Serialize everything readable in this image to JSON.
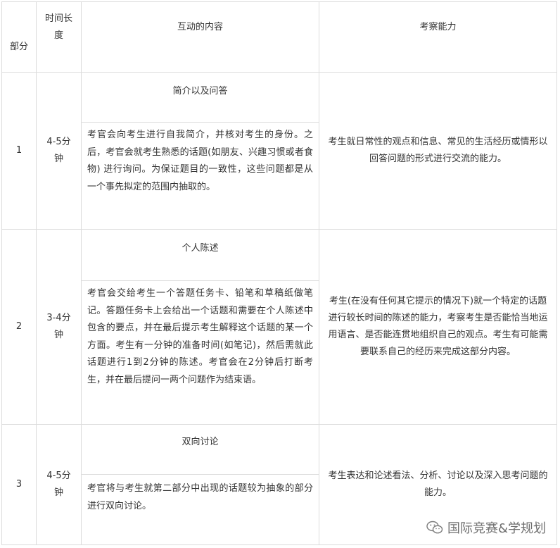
{
  "header": {
    "part": "部分",
    "duration": "时间长度",
    "interaction": "互动的内容",
    "ability": "考察能力"
  },
  "rows": [
    {
      "part": "1",
      "duration": "4-5分钟",
      "title": "简介以及问答",
      "content": "考官会向考生进行自我简介，并核对考生的身份。之后，考官会就考生熟悉的话题(如朋友、兴趣习惯或者食物) 进行询问。为保证题目的一致性，这些问题都是从一个事先拟定的范围内抽取的。",
      "ability": "考生就日常性的观点和信息、常见的生活经历或情形以回答问题的形式进行交流的能力。"
    },
    {
      "part": "2",
      "duration": "3-4分钟",
      "title": "个人陈述",
      "content": "考官会交给考生一个答题任务卡、铅笔和草稿纸做笔记。答题任务卡上会给出一个话题和需要在个人陈述中包含的要点，并在最后提示考生解释这个话题的某一个方面。考生有一分钟的准备时间(如笔记)，然后需就此话题进行1到2分钟的陈述。考官会在2分钟后打断考生，并在最后提问一两个问题作为结束语。",
      "ability": "考生(在没有任何其它提示的情况下)就一个特定的话题进行较长时间的陈述的能力，考察考生是否能恰当地运用语言、是否能连贯地组织自己的观点。考生有可能需要联系自己的经历来完成这部分内容。"
    },
    {
      "part": "3",
      "duration": "4-5分钟",
      "title": "双向讨论",
      "content": "考官将与考生就第二部分中出现的话题较为抽象的部分进行双向讨论。",
      "ability": "考生表达和论述看法、分析、讨论以及深入思考问题的能力。"
    }
  ],
  "watermark": {
    "text": "国际竞赛&学规划",
    "icon": "wechat-icon"
  },
  "colors": {
    "border": "#dcdcdc",
    "text": "#333333"
  }
}
